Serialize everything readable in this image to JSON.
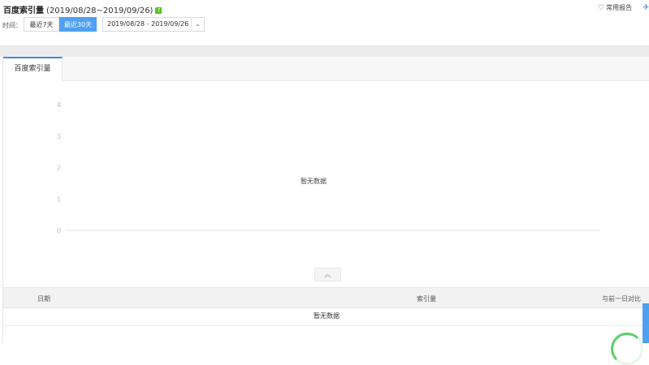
{
  "header": {
    "title": "百度索引量",
    "date_range": "(2019/08/28~2019/09/26)",
    "help_icon": "?",
    "favorite": "常用报告",
    "favorite_icon": "♡",
    "pin_icon": "✈"
  },
  "filters": {
    "time_label": "时间：",
    "btn_7": "最近7天",
    "btn_30": "最近30天",
    "range_text": "2019/08/28 - 2019/09/26",
    "caret": "⌄"
  },
  "tabs": [
    {
      "label": "百度索引量",
      "active": true
    }
  ],
  "chart_data": {
    "type": "line",
    "y_ticks": [
      "4",
      "3",
      "2",
      "1",
      "0"
    ],
    "ylim": [
      0,
      4
    ],
    "series": [],
    "empty_label": "暂无数据"
  },
  "collapse_icon": "︽",
  "table": {
    "columns": [
      "日期",
      "索引量",
      "与前一日对比"
    ],
    "empty_label": "暂无数据"
  },
  "colors": {
    "accent": "#4ea0f2",
    "help": "#52c41a"
  }
}
